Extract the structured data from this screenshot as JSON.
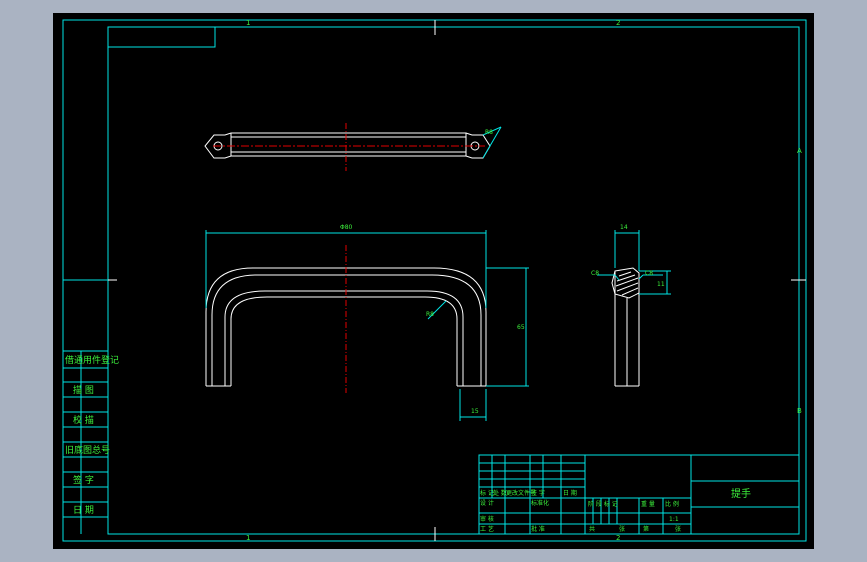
{
  "zones": {
    "top_left": "1",
    "top_right": "2",
    "bottom_left": "1",
    "bottom_right": "2",
    "right_top": "A",
    "right_bottom": "B"
  },
  "side_table": {
    "rows": [
      "借通用件登记",
      "描 图",
      "校 描",
      "旧底图总号",
      "签 字",
      "日 期"
    ]
  },
  "dimensions": {
    "top_view_angle": "R8",
    "front_width": "Φ80",
    "front_height": "65",
    "front_inner_radius": "R8",
    "front_leg_width": "15",
    "side_top": "14",
    "side_chamfer_left": "C8",
    "side_chamfer_right": "C8",
    "side_height": "11"
  },
  "title_block": {
    "part_name": "提手",
    "rev_headers": [
      "标 记",
      "处 数",
      "更改文件号",
      "签 字",
      "日 期"
    ],
    "labels": {
      "design": "设 计",
      "standardize": "标准化",
      "review": "审 核",
      "craft": "工 艺",
      "approve": "批 准",
      "stage_mark": "阶 段 标 记",
      "weight": "重 量",
      "scale": "比 例",
      "scale_value": "1:1",
      "total": "共",
      "sheet": "张",
      "page": "第",
      "page_sheet": "张"
    }
  },
  "colors": {
    "frame": "#00e5e5",
    "outline": "#ffffff",
    "center": "#e00000",
    "text": "#3cf03c",
    "background": "#000000"
  }
}
